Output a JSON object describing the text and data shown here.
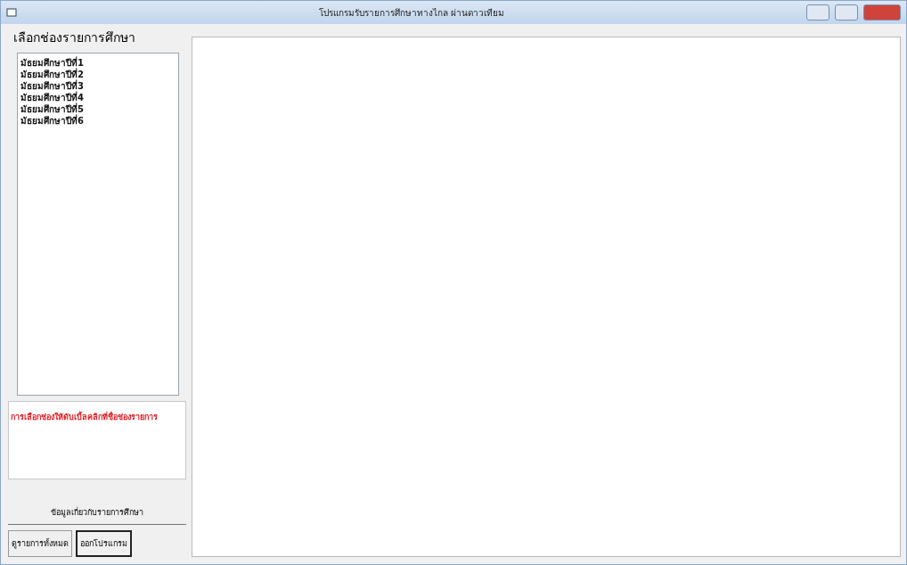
{
  "window": {
    "title": "โปรแกรมรับรายการศึกษาทางไกล ผ่านดาวเทียม"
  },
  "channel_group": {
    "title": "เลือกช่องรายการศึกษา",
    "items": [
      {
        "label": "มัธยมศึกษาปีที่1",
        "selected": false
      },
      {
        "label": "มัธยมศึกษาปีที่2",
        "selected": false
      },
      {
        "label": "มัธยมศึกษาปีที่3",
        "selected": false
      },
      {
        "label": "มัธยมศึกษาปีที่4",
        "selected": false
      },
      {
        "label": "มัธยมศึกษาปีที่5",
        "selected": false
      },
      {
        "label": "มัธยมศึกษาปีที่6",
        "selected": false
      }
    ]
  },
  "notice": "การเลือกช่องให้ดับเบิ้ลคลิกที่ชื่อช่องรายการ",
  "info_label": "ข้อมูลเกี่ยวกับรายการศึกษา",
  "buttons": [
    {
      "label": "ดูรายการทั้งหมด",
      "selected": false
    },
    {
      "label": "ออกโปรแกรม",
      "selected": true
    }
  ]
}
